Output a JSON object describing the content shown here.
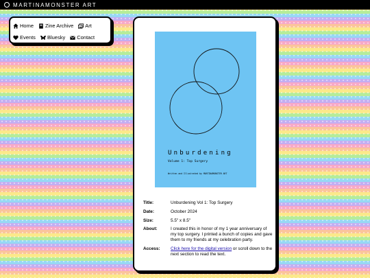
{
  "site": {
    "title": "MARTINAMONSTER ART"
  },
  "nav": {
    "items": [
      {
        "label": "Home",
        "icon": "home-icon"
      },
      {
        "label": "Zine Archive",
        "icon": "book-icon"
      },
      {
        "label": "Art",
        "icon": "gallery-icon"
      },
      {
        "label": "Events",
        "icon": "heart-icon"
      },
      {
        "label": "Bluesky",
        "icon": "butterfly-icon"
      },
      {
        "label": "Contact",
        "icon": "mail-icon"
      }
    ]
  },
  "zine": {
    "cover": {
      "title": "Unburdening",
      "subtitle": "Volume 1: Top Surgery",
      "credit": "Written and Illustrated by MARTINAMONSTER ART",
      "background": "#6ec4f3"
    },
    "details": {
      "title_label": "Title:",
      "title_value": "Unburdening Vol 1: Top Surgery",
      "date_label": "Date:",
      "date_value": "October 2024",
      "size_label": "Size:",
      "size_value": "5.5\" x 8.5\"",
      "about_label": "About:",
      "about_value": "I created this in honor of my 1 year anniversary of my top surgery. I printed a bunch of copies and gave them to my friends at my celebration party.",
      "access_label": "Access:",
      "access_link": "Click here for the digital version",
      "access_rest": " or scroll down to the next section to read the text."
    }
  }
}
